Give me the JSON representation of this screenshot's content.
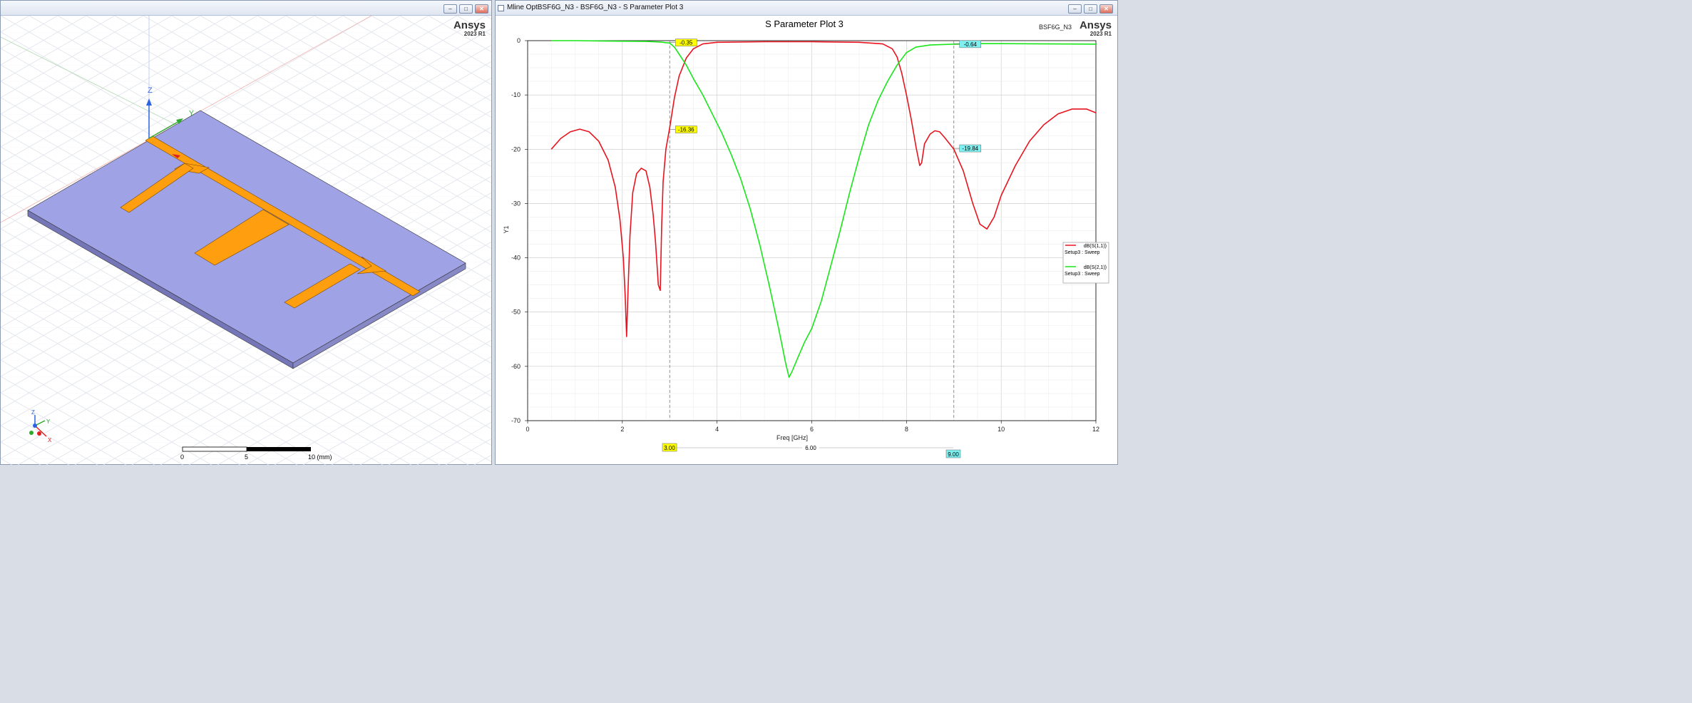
{
  "left_window": {
    "brand": "Ansys",
    "version": "2023 R1",
    "axes": {
      "z": "Z",
      "y": "Y",
      "x": "X"
    },
    "scale_bar": {
      "label_0": "0",
      "label_5": "5",
      "label_10": "10 (mm)"
    },
    "buttons": {
      "minimize": "–",
      "restore": "□",
      "close": "✕"
    },
    "colors": {
      "substrate": "#a0a2e6",
      "metal": "#ff9f0f",
      "background": "#ffffff"
    }
  },
  "right_window": {
    "title": "Mline OptBSF6G_N3 - BSF6G_N3 - S Parameter Plot 3",
    "brand": "Ansys",
    "version": "2023 R1",
    "design_name": "BSF6G_N3",
    "buttons": {
      "minimize": "–",
      "restore": "□",
      "close": "✕"
    },
    "markers": {
      "m1": "-0.35",
      "m2": "-16.36",
      "m3": "-0.64",
      "m4": "-19.84",
      "x_left": "3.00",
      "x_mid": "6.00",
      "x_right": "9.00"
    },
    "legend": [
      {
        "trace": "dB(S(1,1))",
        "solution": "Setup3 : Sweep",
        "color": "#e8131e"
      },
      {
        "trace": "dB(S(2,1))",
        "solution": "Setup3 : Sweep",
        "color": "#19e619"
      }
    ]
  },
  "chart_data": {
    "type": "line",
    "title": "S Parameter Plot 3",
    "xlabel": "Freq [GHz]",
    "ylabel": "Y1",
    "xlim": [
      0,
      12
    ],
    "ylim": [
      -70,
      0
    ],
    "x_ticks": [
      "0",
      "2",
      "4",
      "6",
      "8",
      "10",
      "12"
    ],
    "y_ticks": [
      "0",
      "-10",
      "-20",
      "-30",
      "-40",
      "-50",
      "-60",
      "-70"
    ],
    "grid": true,
    "legend_position": "right",
    "cursor_lines": [
      3.0,
      9.0
    ],
    "series": [
      {
        "name": "dB(S(1,1))",
        "color": "#e8131e",
        "x": [
          0.5,
          0.7,
          0.9,
          1.1,
          1.3,
          1.5,
          1.7,
          1.85,
          1.95,
          2.02,
          2.06,
          2.09,
          2.12,
          2.16,
          2.22,
          2.3,
          2.4,
          2.5,
          2.58,
          2.65,
          2.7,
          2.76,
          2.8,
          2.83,
          2.86,
          2.92,
          3.0,
          3.1,
          3.2,
          3.35,
          3.5,
          3.7,
          4.0,
          5.0,
          6.0,
          7.0,
          7.5,
          7.7,
          7.8,
          7.9,
          8.0,
          8.1,
          8.2,
          8.28,
          8.32,
          8.38,
          8.5,
          8.6,
          8.7,
          8.8,
          9.0,
          9.2,
          9.4,
          9.55,
          9.7,
          9.85,
          10.0,
          10.3,
          10.6,
          10.9,
          11.2,
          11.5,
          11.8,
          12.0
        ],
        "y": [
          -20,
          -18,
          -16.8,
          -16.3,
          -16.8,
          -18.5,
          -22,
          -27,
          -33,
          -40,
          -47,
          -54.5,
          -46,
          -36,
          -28,
          -24.5,
          -23.5,
          -24,
          -27,
          -32,
          -37,
          -45,
          -46,
          -34,
          -26,
          -20,
          -16,
          -10.5,
          -6.5,
          -3.2,
          -1.5,
          -0.6,
          -0.3,
          -0.2,
          -0.2,
          -0.3,
          -0.6,
          -1.5,
          -3,
          -6,
          -10,
          -14.5,
          -19.5,
          -23,
          -22.5,
          -19,
          -17.2,
          -16.6,
          -16.8,
          -17.8,
          -20,
          -24,
          -30,
          -33.8,
          -34.7,
          -32.5,
          -28.5,
          -23,
          -18.5,
          -15.5,
          -13.5,
          -12.6,
          -12.6,
          -13.3
        ]
      },
      {
        "name": "dB(S(2,1))",
        "color": "#19e619",
        "x": [
          0.5,
          1.0,
          1.5,
          2.0,
          2.5,
          2.8,
          3.0,
          3.1,
          3.2,
          3.35,
          3.5,
          3.7,
          3.9,
          4.1,
          4.3,
          4.5,
          4.7,
          4.9,
          5.1,
          5.3,
          5.45,
          5.52,
          5.58,
          5.7,
          5.85,
          6.0,
          6.2,
          6.4,
          6.6,
          6.8,
          7.0,
          7.2,
          7.4,
          7.6,
          7.8,
          8.0,
          8.2,
          8.5,
          9.0,
          9.5,
          10.0,
          11.0,
          12.0
        ],
        "y": [
          0,
          0,
          -0.05,
          -0.1,
          -0.15,
          -0.25,
          -0.45,
          -1.2,
          -2.5,
          -4.5,
          -7,
          -10,
          -13.5,
          -17,
          -21,
          -25.5,
          -31,
          -37.5,
          -45,
          -53,
          -59.5,
          -62,
          -61,
          -58.5,
          -55.5,
          -53,
          -48,
          -41.5,
          -35,
          -28,
          -21.5,
          -15.5,
          -11,
          -7.5,
          -4.5,
          -2.2,
          -1.2,
          -0.8,
          -0.64,
          -0.55,
          -0.55,
          -0.6,
          -0.65
        ]
      }
    ]
  }
}
